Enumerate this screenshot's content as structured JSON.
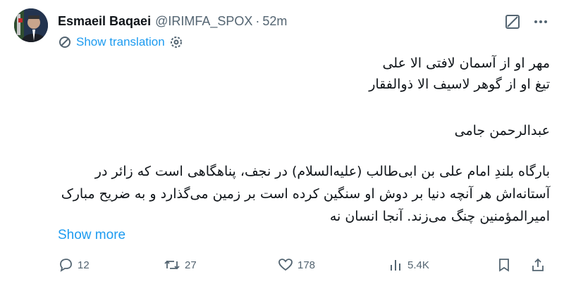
{
  "author": {
    "name": "Esmaeil Baqaei",
    "handle": "@IRIMFA_SPOX",
    "separator": "·",
    "time": "52m"
  },
  "translation": {
    "label": "Show translation"
  },
  "body": {
    "lines": [
      "مهر او از آسمان لافتی الا علی",
      "تیغ او از گوهر لاسیف الا ذوالفقار",
      "عبدالرحمن جامی",
      "بارگاه بلندِ امام علی بن ابی‌طالب (علیه‌السلام) در نجف، پناهگاهی است که زائر در",
      "آستانه‌اش هر آنچه دنیا بر دوش او سنگین کرده است بر زمین می‌گذارد و به ضریح مبارک",
      "امیرالمؤمنین چنگ می‌زند. آنجا انسان نه"
    ]
  },
  "show_more": "Show more",
  "actions": {
    "replies": "12",
    "reposts": "27",
    "likes": "178",
    "views": "5.4K"
  },
  "icons": [
    "grok-icon",
    "more-icon",
    "translate-icon",
    "gear-icon",
    "reply-icon",
    "repost-icon",
    "like-icon",
    "views-icon",
    "bookmark-icon",
    "share-icon"
  ],
  "colors": {
    "accent": "#1d9bf0",
    "muted": "#536471",
    "text": "#0f1419"
  }
}
